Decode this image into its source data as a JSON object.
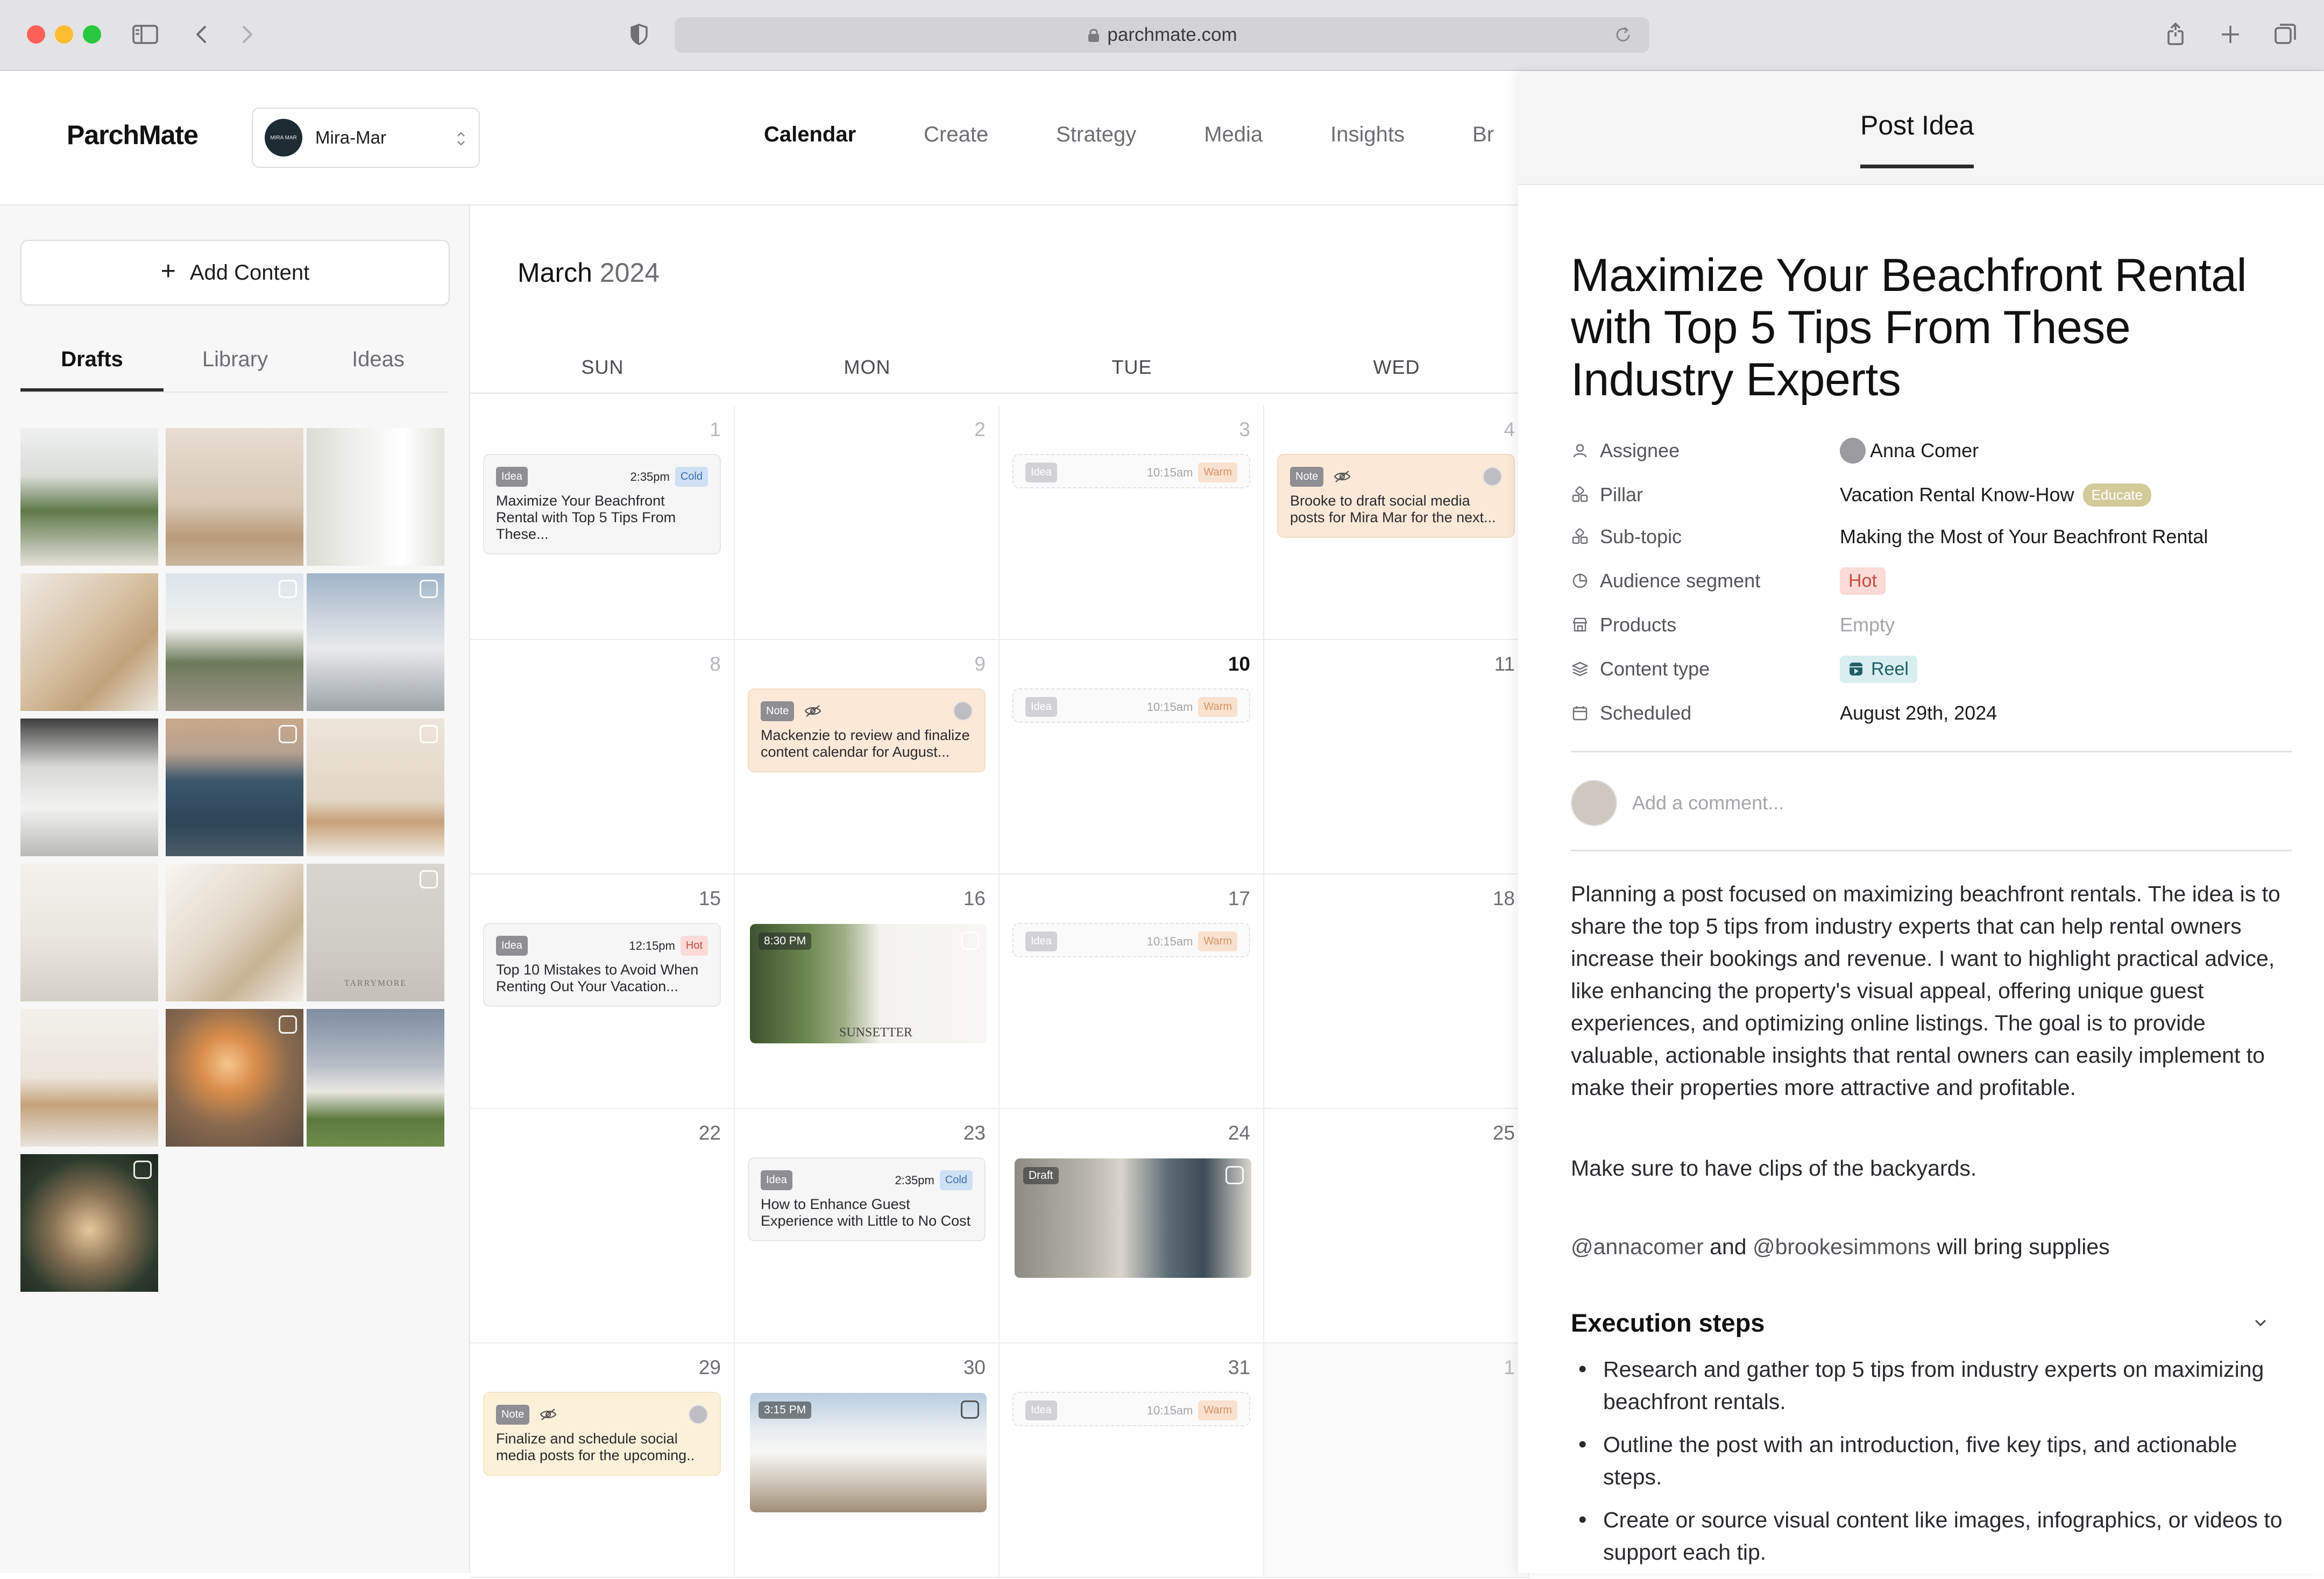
{
  "browser": {
    "url": "parchmate.com"
  },
  "app": {
    "logo": "ParchMate",
    "workspace": {
      "name": "Mira-Mar",
      "avatar_text": "MIRA MAR"
    },
    "nav": [
      "Calendar",
      "Create",
      "Strategy",
      "Media",
      "Insights",
      "Br"
    ]
  },
  "sidebar": {
    "add_button": "Add Content",
    "tabs": [
      "Drafts",
      "Library",
      "Ideas"
    ],
    "thumb_watermark": "TARRYMORE"
  },
  "calendar": {
    "month": "March",
    "year": "2024",
    "days_of_week": [
      "SUN",
      "MON",
      "TUE",
      "WED"
    ],
    "days": {
      "d1": "1",
      "d2": "2",
      "d3": "3",
      "d4": "4",
      "d8": "8",
      "d9": "9",
      "d10": "10",
      "d11": "11",
      "d15": "15",
      "d16": "16",
      "d17": "17",
      "d18": "18",
      "d22": "22",
      "d23": "23",
      "d24": "24",
      "d25": "25",
      "d29": "29",
      "d30": "30",
      "d31": "31",
      "n1": "1"
    },
    "cards": {
      "c1": {
        "tag": "Idea",
        "time": "2:35pm",
        "pill": "Cold",
        "text": "Maximize Your Beachfront Rental with Top 5 Tips From These..."
      },
      "c3": {
        "tag": "Idea",
        "time": "10:15am",
        "pill": "Warm"
      },
      "c4": {
        "tag": "Note",
        "text": "Brooke to draft social media posts for Mira Mar for the next..."
      },
      "c9": {
        "tag": "Note",
        "text": "Mackenzie to review and finalize content calendar for August..."
      },
      "c10": {
        "tag": "Idea",
        "time": "10:15am",
        "pill": "Warm"
      },
      "c15": {
        "tag": "Idea",
        "time": "12:15pm",
        "pill": "Hot",
        "text": "Top 10 Mistakes to Avoid When Renting Out Your Vacation..."
      },
      "c16": {
        "time": "8:30 PM",
        "overlay": "SUNSETTER"
      },
      "c17": {
        "tag": "Idea",
        "time": "10:15am",
        "pill": "Warm"
      },
      "c23": {
        "tag": "Idea",
        "time": "2:35pm",
        "pill": "Cold",
        "text": "How to Enhance Guest Experience with Little to No Cost"
      },
      "c24": {
        "tag": "Draft"
      },
      "c29": {
        "tag": "Note",
        "text": "Finalize and schedule social media posts for the upcoming.."
      },
      "c30": {
        "time": "3:15 PM"
      },
      "c31": {
        "tag": "Idea",
        "time": "10:15am",
        "pill": "Warm"
      }
    }
  },
  "panel": {
    "tab": "Post Idea",
    "title": "Maximize Your Beachfront Rental with Top 5 Tips From These Industry Experts",
    "props": {
      "assignee": {
        "label": "Assignee",
        "value": "Anna Comer"
      },
      "pillar": {
        "label": "Pillar",
        "value": "Vacation Rental Know-How",
        "badge": "Educate"
      },
      "subtopic": {
        "label": "Sub-topic",
        "value": "Making the Most of Your Beachfront Rental"
      },
      "audience": {
        "label": "Audience segment",
        "value": "Hot"
      },
      "products": {
        "label": "Products",
        "value": "Empty"
      },
      "content_type": {
        "label": "Content type",
        "value": "Reel"
      },
      "scheduled": {
        "label": "Scheduled",
        "value": "August 29th, 2024"
      }
    },
    "comment_placeholder": "Add a comment...",
    "description": "Planning a post focused on maximizing beachfront rentals. The idea is to share the top 5 tips from industry experts that can help rental owners increase their bookings and revenue. I want to highlight practical advice, like enhancing the property's visual appeal, offering unique guest experiences, and optimizing online listings. The goal is to provide valuable, actionable insights that rental owners can easily implement to make their properties more attractive and profitable.",
    "note": "Make sure to have clips of the backyards.",
    "mention_1": "@annacomer",
    "mention_and": " and ",
    "mention_2": "@brookesimmons",
    "mention_tail": " will bring supplies",
    "execution_heading": "Execution steps",
    "execution_steps": [
      "Research and gather top 5 tips from industry experts on maximizing beachfront rentals.",
      "Outline the post with an introduction, five key tips, and actionable steps.",
      "Create or source visual content like images, infographics, or videos to support each tip."
    ]
  }
}
